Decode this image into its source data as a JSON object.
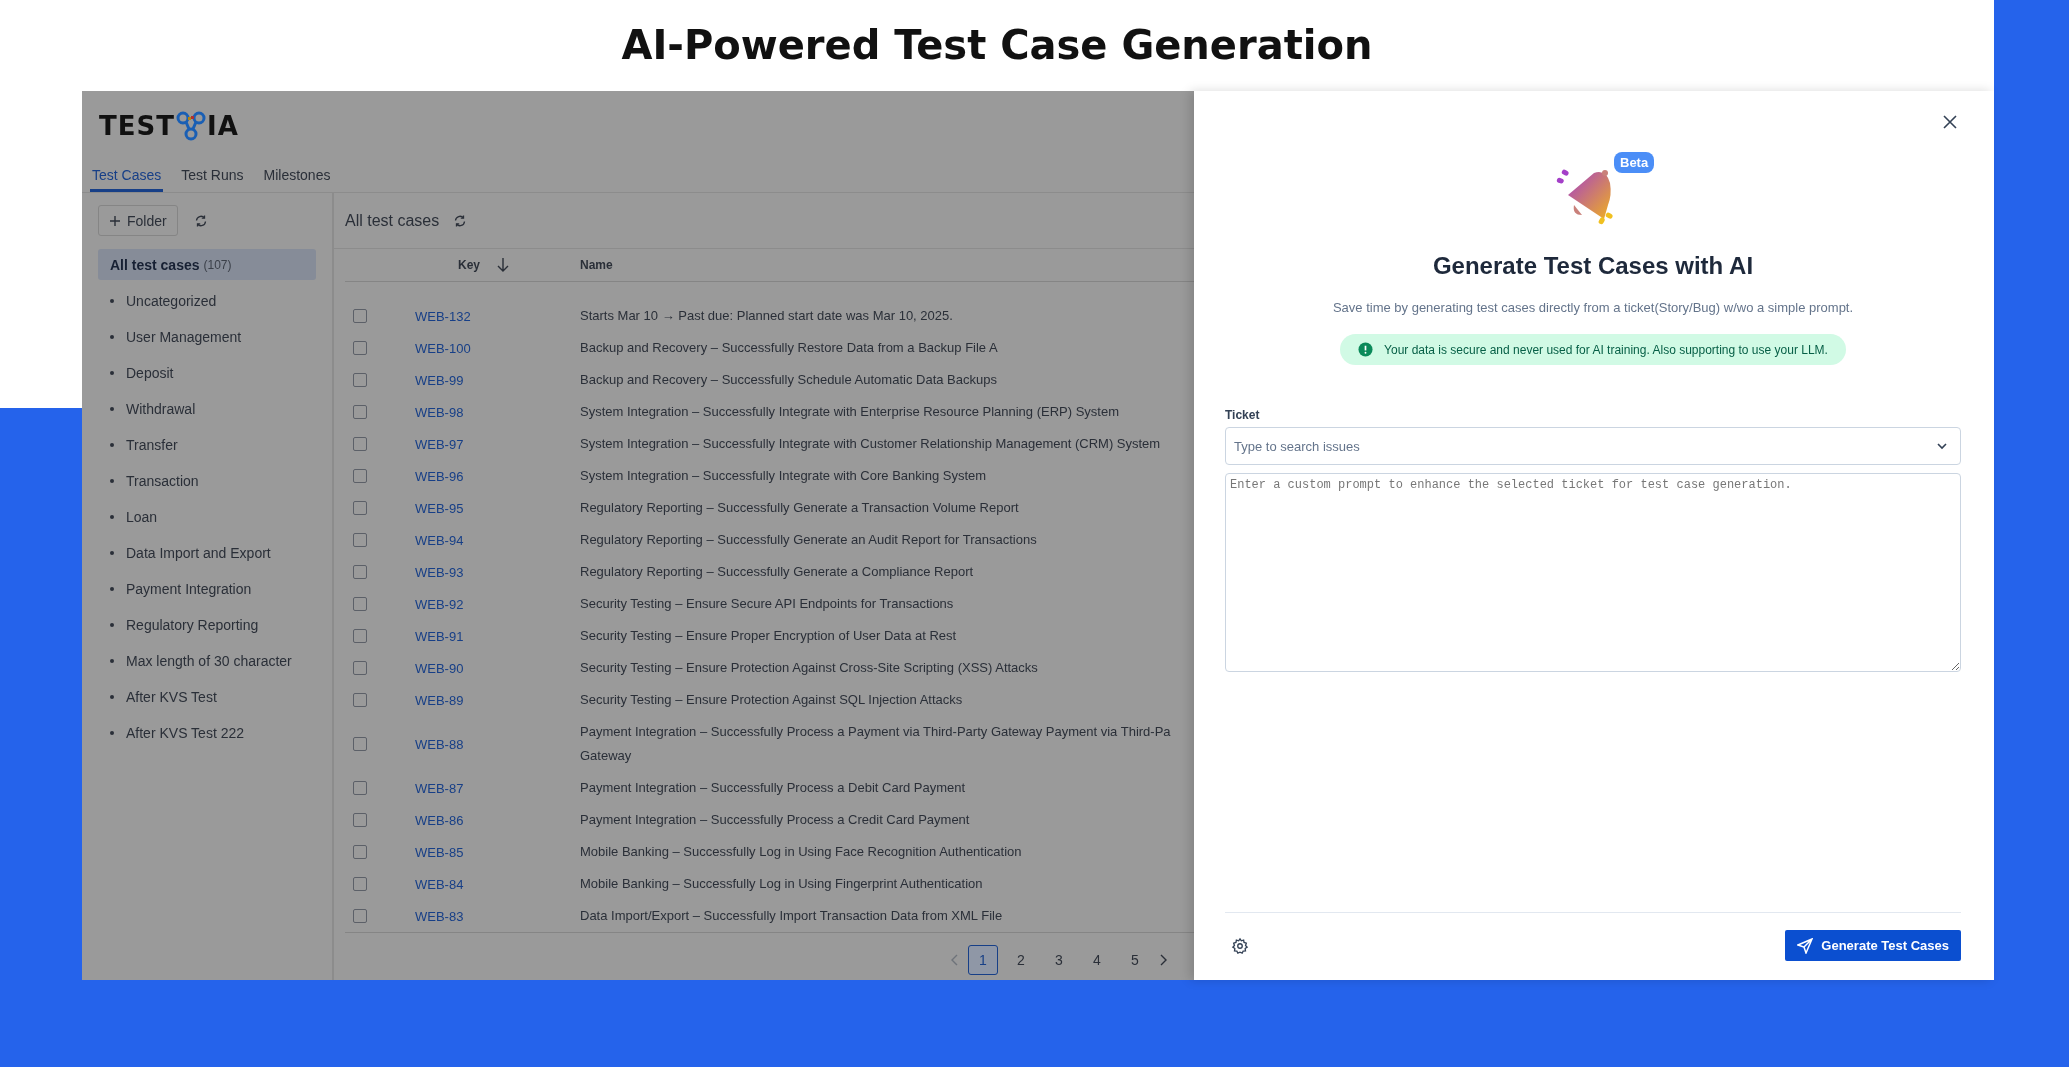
{
  "page_title": "AI-Powered Test Case Generation",
  "logo": {
    "parts": [
      "TEST",
      "IA"
    ]
  },
  "tabs": [
    {
      "label": "Test Cases",
      "selected": true
    },
    {
      "label": "Test Runs",
      "selected": false
    },
    {
      "label": "Milestones",
      "selected": false
    }
  ],
  "sidebar": {
    "add_button": "Folder",
    "items": [
      {
        "label": "All test cases",
        "count": "(107)",
        "selected": true
      },
      {
        "label": "Uncategorized",
        "selected": false
      },
      {
        "label": "User Management",
        "selected": false
      },
      {
        "label": "Deposit",
        "selected": false
      },
      {
        "label": "Withdrawal",
        "selected": false
      },
      {
        "label": "Transfer",
        "selected": false
      },
      {
        "label": "Transaction",
        "selected": false
      },
      {
        "label": "Loan",
        "selected": false
      },
      {
        "label": "Data Import and Export",
        "selected": false
      },
      {
        "label": "Payment Integration",
        "selected": false
      },
      {
        "label": "Regulatory Reporting",
        "selected": false
      },
      {
        "label": "Max length of 30 character",
        "selected": false
      },
      {
        "label": "After KVS Test",
        "selected": false
      },
      {
        "label": "After KVS Test 222",
        "selected": false
      }
    ]
  },
  "table": {
    "title": "All test cases",
    "columns": [
      "Key",
      "Name"
    ],
    "rows": [
      {
        "key": "WEB-132",
        "name": "Starts Mar 10 → Past due: Planned start date was Mar 10, 2025.",
        "checked": false
      },
      {
        "key": "WEB-100",
        "name": "Backup and Recovery – Successfully Restore Data from a Backup File A",
        "checked": false
      },
      {
        "key": "WEB-99",
        "name": "Backup and Recovery – Successfully Schedule Automatic Data Backups",
        "checked": false
      },
      {
        "key": "WEB-98",
        "name": "System Integration – Successfully Integrate with Enterprise Resource Planning (ERP) System",
        "checked": false
      },
      {
        "key": "WEB-97",
        "name": "System Integration – Successfully Integrate with Customer Relationship Management (CRM) System",
        "checked": false
      },
      {
        "key": "WEB-96",
        "name": "System Integration – Successfully Integrate with Core Banking System",
        "checked": false
      },
      {
        "key": "WEB-95",
        "name": "Regulatory Reporting – Successfully Generate a Transaction Volume Report",
        "checked": false
      },
      {
        "key": "WEB-94",
        "name": "Regulatory Reporting – Successfully Generate an Audit Report for Transactions",
        "checked": false
      },
      {
        "key": "WEB-93",
        "name": "Regulatory Reporting – Successfully Generate a Compliance Report",
        "checked": false
      },
      {
        "key": "WEB-92",
        "name": "Security Testing – Ensure Secure API Endpoints for Transactions",
        "checked": false
      },
      {
        "key": "WEB-91",
        "name": "Security Testing – Ensure Proper Encryption of User Data at Rest",
        "checked": false
      },
      {
        "key": "WEB-90",
        "name": "Security Testing – Ensure Protection Against Cross-Site Scripting (XSS) Attacks",
        "checked": false
      },
      {
        "key": "WEB-89",
        "name": "Security Testing – Ensure Protection Against SQL Injection Attacks",
        "checked": false
      },
      {
        "key": "WEB-88",
        "name": "Payment Integration – Successfully Process a Payment via Third-Party Gateway Payment via Third-Pa\nGateway",
        "checked": false
      },
      {
        "key": "WEB-87",
        "name": "Payment Integration – Successfully Process a Debit Card Payment",
        "checked": false
      },
      {
        "key": "WEB-86",
        "name": "Payment Integration – Successfully Process a Credit Card Payment",
        "checked": false
      },
      {
        "key": "WEB-85",
        "name": "Mobile Banking – Successfully Log in Using Face Recognition Authentication",
        "checked": false
      },
      {
        "key": "WEB-84",
        "name": "Mobile Banking – Successfully Log in Using Fingerprint Authentication",
        "checked": false
      },
      {
        "key": "WEB-83",
        "name": "Data Import/Export – Successfully Import Transaction Data from XML File",
        "checked": false
      }
    ]
  },
  "pagination": {
    "pages": [
      {
        "label": "1",
        "selected": true
      },
      {
        "label": "2",
        "selected": false
      },
      {
        "label": "3",
        "selected": false
      },
      {
        "label": "4",
        "selected": false
      },
      {
        "label": "5",
        "selected": false
      }
    ]
  },
  "drawer": {
    "badge": "Beta",
    "title": "Generate Test Cases with AI",
    "subtitle": "Save time by generating test cases directly from a ticket(Story/Bug) w/wo a simple prompt.",
    "notice": "Your data is secure and never used for AI training. Also supporting to use your LLM.",
    "ticket_label": "Ticket",
    "ticket_placeholder": "Type to search issues",
    "prompt_placeholder": "Enter a custom prompt to enhance the selected ticket for test case generation.",
    "submit_button": "Generate Test Cases"
  }
}
